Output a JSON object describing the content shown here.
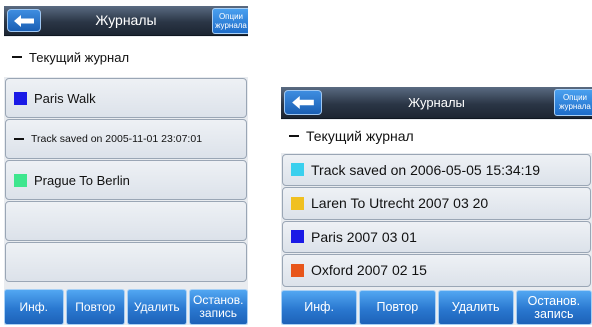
{
  "left": {
    "title": "Журналы",
    "options": [
      "Опции",
      "журнала"
    ],
    "rows": [
      {
        "label": "Текущий журнал",
        "kind": "dash",
        "current": true
      },
      {
        "label": "Paris Walk",
        "kind": "swatch",
        "color": "#1a1ae6"
      },
      {
        "label": "Track saved on 2005-11-01 23:07:01",
        "kind": "dash"
      },
      {
        "label": "Prague To Berlin",
        "kind": "swatch",
        "color": "#3ee68e"
      },
      {
        "label": "",
        "kind": "empty"
      },
      {
        "label": "",
        "kind": "empty"
      }
    ],
    "buttons": {
      "info": "Инф.",
      "repeat": "Повтор",
      "delete": "Удалить",
      "stop_l1": "Останов.",
      "stop_l2": "запись"
    }
  },
  "right": {
    "title": "Журналы",
    "options": [
      "Опции",
      "журнала"
    ],
    "rows": [
      {
        "label": "Текущий журнал",
        "kind": "dash",
        "current": true
      },
      {
        "label": "Track saved on 2006-05-05 15:34:19",
        "kind": "swatch",
        "color": "#3ad0ee"
      },
      {
        "label": "Laren To Utrecht 2007 03 20",
        "kind": "swatch",
        "color": "#f0c020"
      },
      {
        "label": "Paris 2007 03 01",
        "kind": "swatch",
        "color": "#1a1ae6"
      },
      {
        "label": "Oxford 2007 02 15",
        "kind": "swatch",
        "color": "#e8561a"
      }
    ],
    "buttons": {
      "info": "Инф.",
      "repeat": "Повтор",
      "delete": "Удалить",
      "stop_l1": "Останов.",
      "stop_l2": "запись"
    }
  },
  "colors": {
    "accent": "#2a78d0",
    "title_bar": "#2b3646"
  }
}
